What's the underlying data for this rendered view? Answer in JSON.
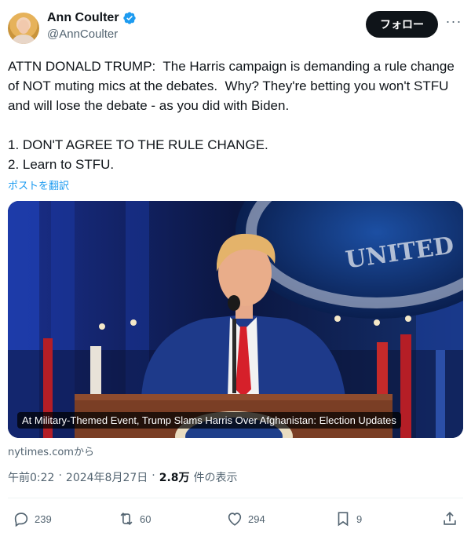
{
  "user": {
    "name": "Ann Coulter",
    "handle": "@AnnCoulter",
    "follow_label": "フォロー",
    "more_label": "···"
  },
  "tweet": {
    "text": "ATTN DONALD TRUMP:  The Harris campaign is demanding a rule change of NOT muting mics at the debates.  Why? They're betting you won't STFU and will lose the debate - as you did with Biden.\n\n1. DON'T AGREE TO THE RULE CHANGE.\n2. Learn to STFU.",
    "translate_label": "ポストを翻訳"
  },
  "card": {
    "caption": "At Military-Themed Event, Trump Slams Harris Over Afghanistan: Election Updates",
    "source": "nytimes.comから",
    "banner_text": "UNITED"
  },
  "meta": {
    "time": "午前0:22",
    "date": "2024年8月27日",
    "separator": "·",
    "views": "2.8万",
    "views_label": "件の表示"
  },
  "actions": {
    "replies": "239",
    "reposts": "60",
    "likes": "294",
    "bookmarks": "9"
  },
  "colors": {
    "accent": "#1d9bf0",
    "text": "#0f1419",
    "secondary": "#536471"
  }
}
